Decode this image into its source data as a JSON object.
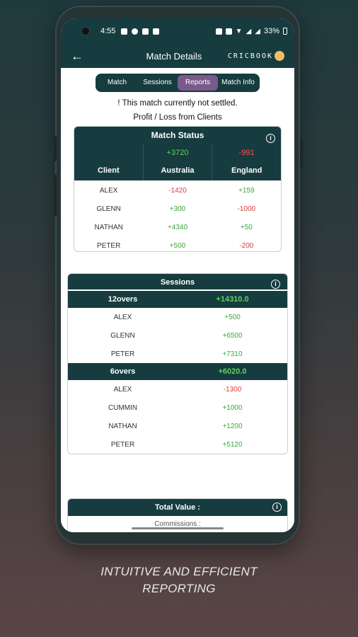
{
  "status_bar": {
    "time": "4:55",
    "battery": "33%"
  },
  "app_bar": {
    "back_icon": "arrow-left-icon",
    "title": "Match Details",
    "logo": "CRICBOOK"
  },
  "tabs": [
    {
      "label": "Match"
    },
    {
      "label": "Sessions"
    },
    {
      "label": "Reports",
      "active": true
    },
    {
      "label": "Match Info"
    }
  ],
  "notice": "! This match currently not settled.",
  "subtitle": "Profit / Loss from Clients",
  "match_status": {
    "title": "Match Status",
    "col_client": "Client",
    "teams": [
      {
        "name": "Australia",
        "total": "+3720"
      },
      {
        "name": "England",
        "total": "-991"
      }
    ],
    "rows": [
      {
        "client": "ALEX",
        "australia": "-1420",
        "england": "+159"
      },
      {
        "client": "GLENN",
        "australia": "+300",
        "england": "-1000"
      },
      {
        "client": "NATHAN",
        "australia": "+4340",
        "england": "+50"
      },
      {
        "client": "PETER",
        "australia": "+500",
        "england": "-200"
      }
    ]
  },
  "sessions": {
    "title": "Sessions",
    "groups": [
      {
        "name": "12overs",
        "total": "+14310.0",
        "rows": [
          {
            "client": "ALEX",
            "value": "+500"
          },
          {
            "client": "GLENN",
            "value": "+6500"
          },
          {
            "client": "PETER",
            "value": "+7310"
          }
        ]
      },
      {
        "name": "6overs",
        "total": "+6020.0",
        "rows": [
          {
            "client": "ALEX",
            "value": "-1300"
          },
          {
            "client": "CUMMIN",
            "value": "+1000"
          },
          {
            "client": "NATHAN",
            "value": "+1200"
          },
          {
            "client": "PETER",
            "value": "+5120"
          }
        ]
      }
    ]
  },
  "total_value": {
    "title": "Total Value :",
    "commissions": "Commissions :"
  },
  "caption": {
    "line1": "INTUITIVE AND EFFICIENT",
    "line2": "REPORTING"
  },
  "colors": {
    "primary": "#163c3f",
    "active_tab": "#7a5a8a",
    "positive": "#3aa83a",
    "negative": "#e03a3a"
  }
}
